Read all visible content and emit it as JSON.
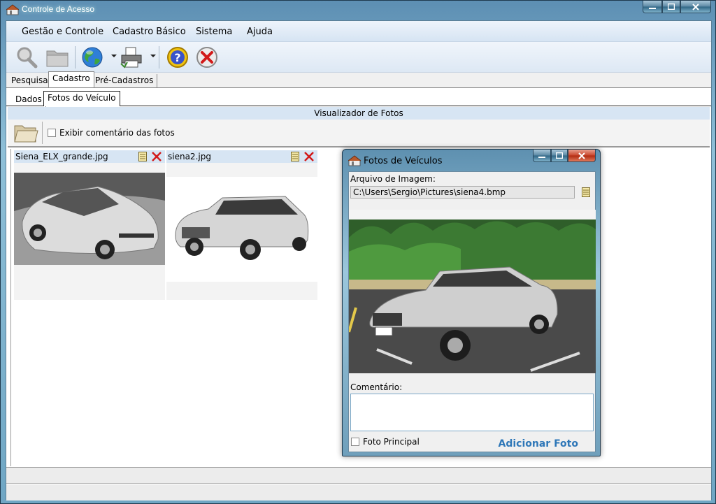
{
  "window": {
    "title": "Controle de Acesso"
  },
  "menu": {
    "items": [
      "Gestão e Controle",
      "Cadastro Básico",
      "Sistema",
      "Ajuda"
    ]
  },
  "toolbar": {
    "icons": [
      "magnifier-icon",
      "folder-icon",
      "globe-icon",
      "printer-icon",
      "help-icon",
      "close-circle-icon"
    ]
  },
  "tabs_top": {
    "items": [
      "Pesquisa",
      "Cadastro",
      "Pré-Cadastros"
    ],
    "selected": "Cadastro"
  },
  "tabs_sub": {
    "items": [
      "Dados",
      "Fotos do Veículo"
    ],
    "selected": "Fotos do Veículo"
  },
  "viewer": {
    "header": "Visualizador de Fotos",
    "show_comments_label": "Exibir comentário das fotos",
    "photos": [
      {
        "filename": "Siena_ELX_grande.jpg"
      },
      {
        "filename": "siena2.jpg"
      }
    ]
  },
  "dialog": {
    "title": "Fotos de Veículos",
    "file_label": "Arquivo de Imagem:",
    "file_path": "C:\\Users\\Sergio\\Pictures\\siena4.bmp",
    "comment_label": "Comentário:",
    "main_photo_label": "Foto Principal",
    "add_button": "Adicionar Foto"
  },
  "colors": {
    "accent": "#2e77b8",
    "header_band": "#d7e5f3",
    "close_red": "#d21a1a"
  }
}
